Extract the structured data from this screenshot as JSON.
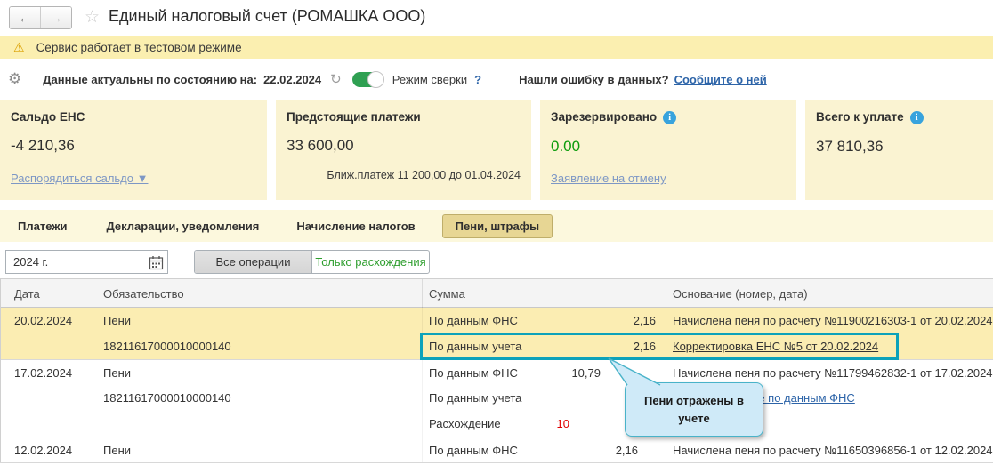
{
  "colors": {
    "accent_teal": "#0da2ba",
    "link_blue": "#2d64a8",
    "muted_card_link": "#7d97c5",
    "positive_green": "#0d9c0d",
    "discrepancy_red": "#e00000",
    "banner_yellow": "#fbefb0",
    "card_yellow": "#faf3d2",
    "selected_row_yellow": "#fbedb2",
    "active_tab": "#e7d694",
    "tooltip_blue": "#cfeaf8"
  },
  "icons": {
    "back": "←",
    "forward": "→",
    "favorite": "☆",
    "warning": "⚠",
    "settings": "⚙",
    "refresh": "↻",
    "help": "?",
    "info": "i"
  },
  "window": {
    "title": "Единый налоговый счет (РОМАШКА ООО)"
  },
  "banner": {
    "text": "Сервис работает в тестовом режиме"
  },
  "toolbar": {
    "actuality_label": "Данные актуальны по состоянию на:",
    "actuality_date": "22.02.2024",
    "mode_label": "Режим сверки",
    "error_question": "Нашли ошибку в данных?",
    "error_link": "Сообщите о ней"
  },
  "cards": [
    {
      "title": "Сальдо ЕНС",
      "value": "-4 210,36",
      "link": "Распорядиться сальдо ▼"
    },
    {
      "title": "Предстоящие платежи",
      "value": "33 600,00",
      "note": "Ближ.платеж 11 200,00 до 01.04.2024"
    },
    {
      "title": "Зарезервировано",
      "value": "0.00",
      "link": "Заявление на отмену",
      "has_info": true
    },
    {
      "title": "Всего к уплате",
      "value": "37 810,36",
      "has_info": true
    }
  ],
  "tabs": [
    {
      "label": "Платежи",
      "active": false
    },
    {
      "label": "Декларации, уведомления",
      "active": false
    },
    {
      "label": "Начисление налогов",
      "active": false
    },
    {
      "label": "Пени, штрафы",
      "active": true
    }
  ],
  "filters": {
    "period": "2024 г.",
    "segments": [
      {
        "label": "Все операции",
        "active": true
      },
      {
        "label": "Только расхождения",
        "active": false
      }
    ]
  },
  "table": {
    "columns": [
      "Дата",
      "Обязательство",
      "Сумма",
      "Основание (номер, дата)"
    ],
    "rows": [
      {
        "date": "20.02.2024",
        "obligation": "Пени",
        "sum_label": "По данным ФНС",
        "sum_value": "2,16",
        "basis": "Начислена пеня по расчету №11900216303-1 от 20.02.2024"
      },
      {
        "date": "",
        "obligation": "18211617000010000140",
        "sum_label": "По данным учета",
        "sum_value": "2,16",
        "basis": "Корректировка ЕНС №5 от 20.02.2024"
      },
      {
        "date": "17.02.2024",
        "obligation": "Пени",
        "sum_label": "По данным ФНС",
        "sum_value": "10,79",
        "basis": "Начислена пеня по расчету №11799462832-1 от 17.02.2024"
      },
      {
        "date": "",
        "obligation": "18211617000010000140",
        "sum_label": "По данным учета",
        "sum_value": "",
        "basis": "Отразить в учете по данным ФНС"
      },
      {
        "date": "",
        "obligation": "",
        "sum_label": "Расхождение",
        "sum_value": "10",
        "basis": ""
      },
      {
        "date": "12.02.2024",
        "obligation": "Пени",
        "sum_label": "По данным ФНС",
        "sum_value": "2,16",
        "basis": "Начислена пеня по расчету №11650396856-1 от 12.02.2024"
      }
    ]
  },
  "tooltip": {
    "text": "Пени отражены в учете"
  }
}
